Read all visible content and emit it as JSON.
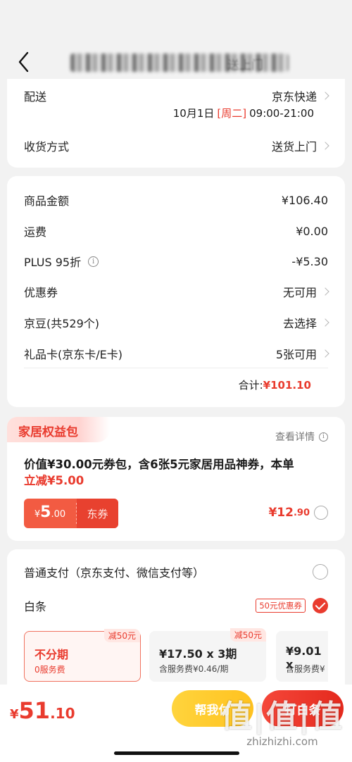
{
  "nav": {
    "title_visible": "送上门"
  },
  "delivery": {
    "label": "配送",
    "carrier": "京东快递",
    "date": "10月1日",
    "weekday": "[周二]",
    "time": "09:00-21:00",
    "receive_label": "收货方式",
    "receive_value": "送货上门"
  },
  "summary": {
    "goods_label": "商品金额",
    "goods_value": "¥106.40",
    "freight_label": "运费",
    "freight_value": "¥0.00",
    "plus_label": "PLUS 95折",
    "plus_value": "-¥5.30",
    "coupon_label": "优惠券",
    "coupon_value": "无可用",
    "jd_bean_label": "京豆(共529个)",
    "jd_bean_value": "去选择",
    "giftcard_label": "礼品卡(京东卡/E卡)",
    "giftcard_value": "5张可用",
    "total_label": "合计:",
    "total_value": "¥101.10"
  },
  "package": {
    "tag": "家居权益包",
    "detail": "查看详情",
    "desc_main": "价值¥30.00元券包，含6张5元家居用品神券，本单",
    "desc_highlight": "立减¥5.00",
    "coupon_sym": "¥",
    "coupon_int": "5",
    "coupon_dec": ".00",
    "coupon_label": "东券",
    "price_int": "¥12",
    "price_dec": ".90"
  },
  "payment": {
    "normal_label": "普通支付（京东支付、微信支付等）",
    "baitiao_label": "白条",
    "baitiao_badge": "50元优惠券",
    "plans": [
      {
        "tag": "减50元",
        "main": "不分期",
        "sub": "0服务费"
      },
      {
        "tag": "减50元",
        "main": "¥17.50 x 3期",
        "sub": "含服务费¥0.46/期"
      },
      {
        "tag": "",
        "main": "¥9.01 x",
        "sub": "含服务费¥"
      }
    ]
  },
  "bottom": {
    "total_sym": "¥",
    "total_int": "51",
    "total_dec": ".10",
    "help_pay": "帮我付",
    "pay": "打白条"
  },
  "watermark": {
    "logo": "值|值|值",
    "url": "zhizhizhi.com"
  }
}
